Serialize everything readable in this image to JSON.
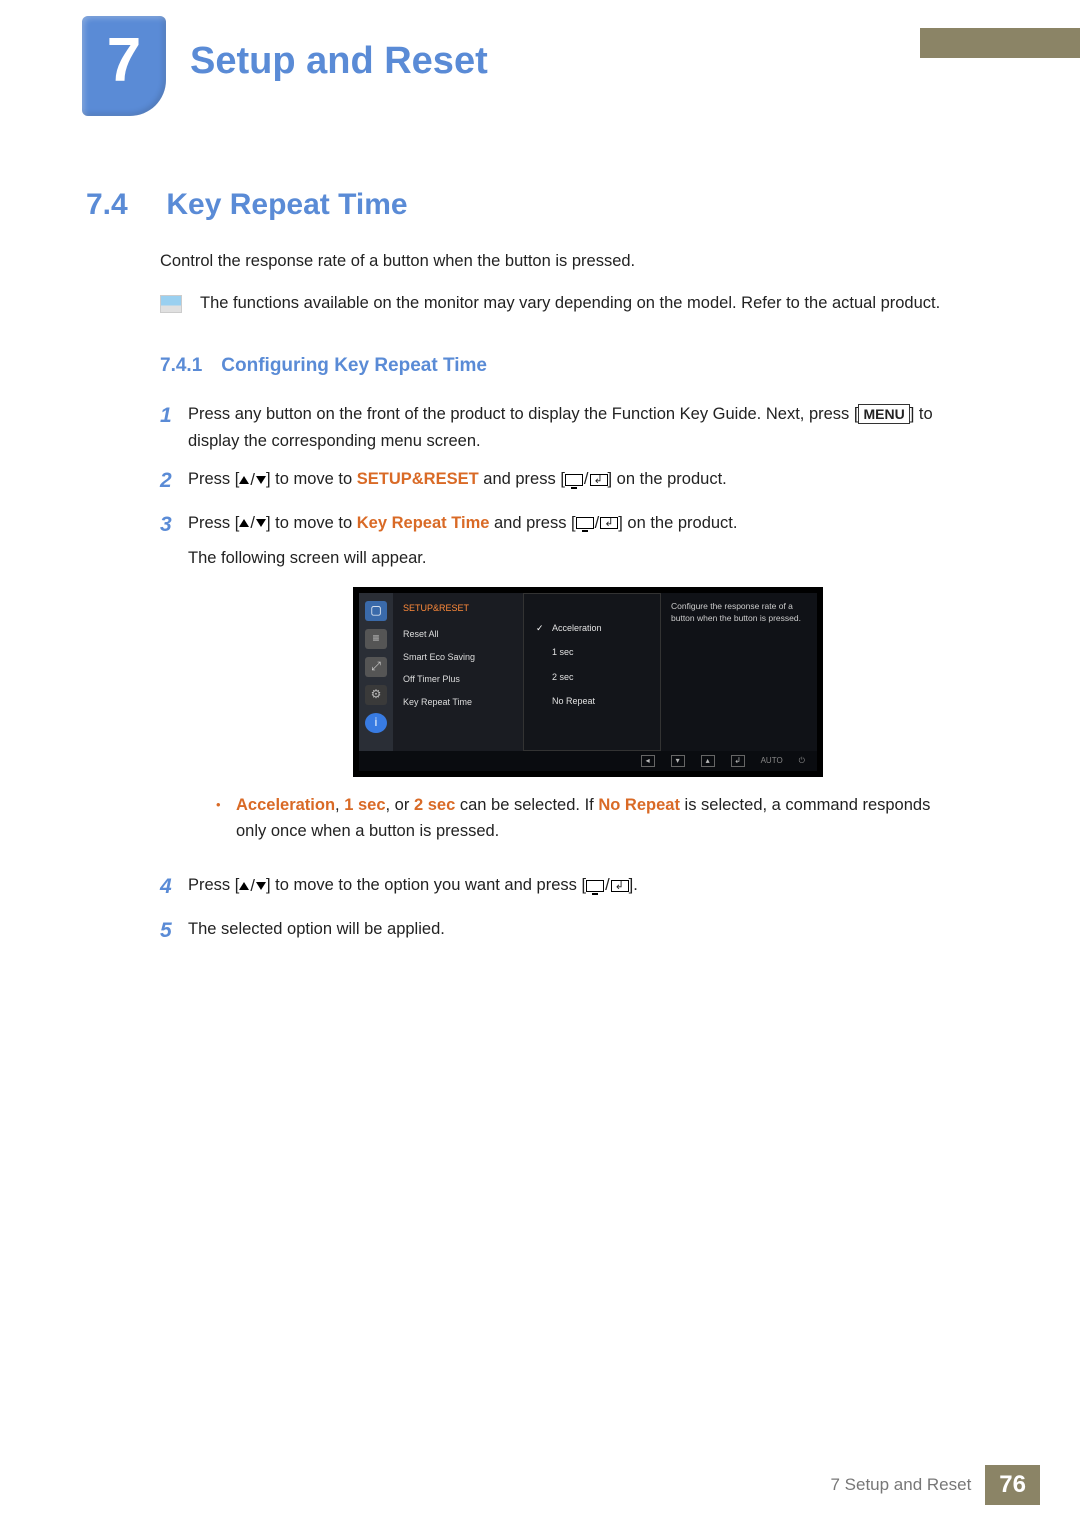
{
  "chapter": {
    "number": "7",
    "title": "Setup and Reset"
  },
  "section": {
    "number": "7.4",
    "title": "Key Repeat Time"
  },
  "intro": "Control the response rate of a button when the button is pressed.",
  "note": "The functions available on the monitor may vary depending on the model. Refer to the actual product.",
  "subheading": {
    "number": "7.4.1",
    "title": "Configuring Key Repeat Time"
  },
  "steps": {
    "s1a": "Press any button on the front of the product to display the Function Key Guide. Next, press [",
    "s1_menu": "MENU",
    "s1b": "] to display the corresponding menu screen.",
    "s2a": "Press [",
    "s2b": "] to move to ",
    "s2_target": "SETUP&RESET",
    "s2c": " and press [",
    "s2d": "] on the product.",
    "s3a": "Press [",
    "s3b": "] to move to ",
    "s3_target": "Key Repeat Time",
    "s3c": " and press [",
    "s3d": "] on the product.",
    "s3_note": "The following screen will appear.",
    "s4a": "Press [",
    "s4b": "] to move to the option you want and press [",
    "s4c": "].",
    "s5": "The selected option will be applied."
  },
  "bullet": {
    "opt1": "Acceleration",
    "sep": ", ",
    "opt2": "1 sec",
    "mid1": ", or ",
    "opt3": "2 sec",
    "mid2": " can be selected. If ",
    "opt4": "No Repeat",
    "tail": " is selected, a command responds only once when a button is pressed."
  },
  "osd": {
    "title": "SETUP&RESET",
    "items": [
      "Reset All",
      "Smart Eco Saving",
      "Off Timer Plus",
      "Key Repeat Time"
    ],
    "options": [
      "Acceleration",
      "1 sec",
      "2 sec",
      "No Repeat"
    ],
    "desc": "Configure the response rate of a button when the button is pressed.",
    "nav_auto": "AUTO"
  },
  "footer": {
    "chapter_ref": "7 Setup and Reset",
    "page": "76"
  }
}
